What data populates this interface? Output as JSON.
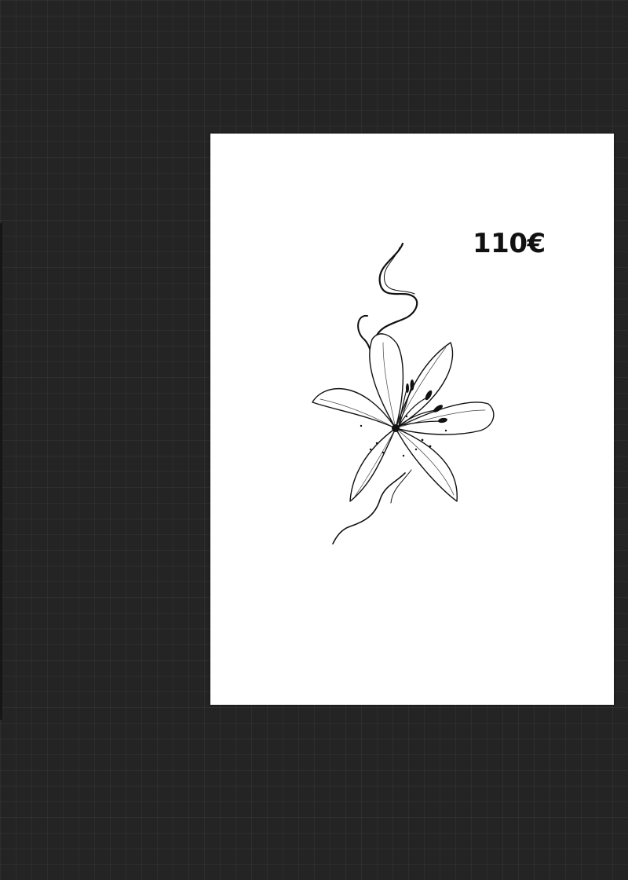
{
  "artwork": {
    "price": "110€",
    "subject": "lily-flower-sketch-icon"
  },
  "colors": {
    "canvas_background": "#242424",
    "paper": "#ffffff",
    "ink": "#111111"
  }
}
